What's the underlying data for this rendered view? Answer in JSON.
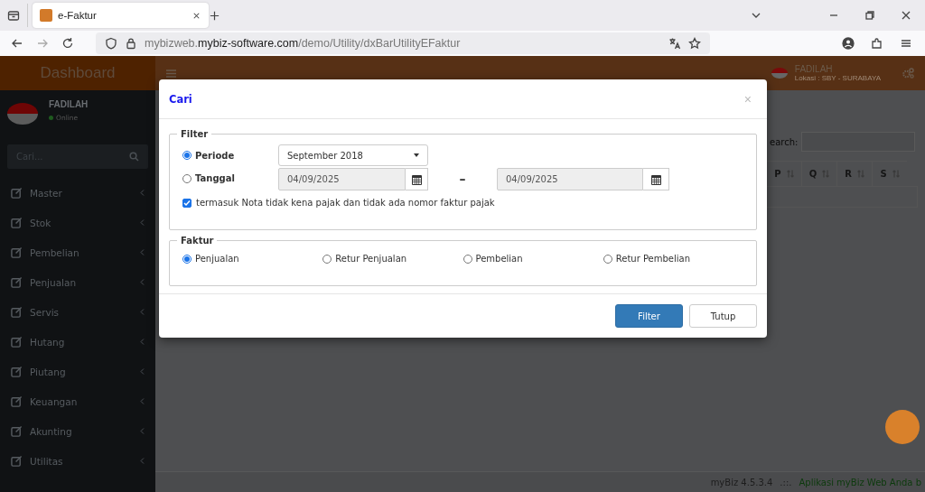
{
  "browser": {
    "tab_title": "e-Faktur",
    "url": {
      "subdomain": "mybizweb.",
      "domain": "mybiz-software.com",
      "path": "/demo/Utility/dxBarUtilityEFaktur"
    }
  },
  "header": {
    "brand": "Dashboard",
    "user_name": "FADILAH",
    "location": "Lokasi : SBY - SURABAYA"
  },
  "sidebar": {
    "user_name": "FADILAH",
    "status": "Online",
    "search": {
      "placeholder": "Cari..."
    },
    "items": [
      {
        "label": "Master"
      },
      {
        "label": "Stok"
      },
      {
        "label": "Pembelian"
      },
      {
        "label": "Penjualan"
      },
      {
        "label": "Servis"
      },
      {
        "label": "Hutang"
      },
      {
        "label": "Piutang"
      },
      {
        "label": "Keuangan"
      },
      {
        "label": "Akunting"
      },
      {
        "label": "Utilitas"
      }
    ]
  },
  "background_table": {
    "search_label": "earch:",
    "columns": [
      "P",
      "Q",
      "R",
      "S"
    ]
  },
  "modal": {
    "title": "Cari",
    "close": "×",
    "filter": {
      "legend": "Filter",
      "modes": [
        {
          "label": "Periode",
          "selected": true
        },
        {
          "label": "Tanggal",
          "selected": false
        }
      ],
      "period": {
        "value": "September 2018"
      },
      "date_from": {
        "value": "04/09/2025",
        "disabled": true
      },
      "range_separator": "–",
      "date_to": {
        "value": "04/09/2025",
        "disabled": true
      },
      "include_non_tax": {
        "label": "termasuk Nota tidak kena pajak dan tidak ada nomor faktur pajak",
        "checked": true
      }
    },
    "faktur": {
      "legend": "Faktur",
      "options": [
        {
          "label": "Penjualan",
          "selected": true
        },
        {
          "label": "Retur Penjualan",
          "selected": false
        },
        {
          "label": "Pembelian",
          "selected": false
        },
        {
          "label": "Retur Pembelian",
          "selected": false
        }
      ]
    },
    "buttons": [
      {
        "label": "Filter",
        "kind": "primary"
      },
      {
        "label": "Tutup",
        "kind": "default"
      }
    ]
  },
  "footer": {
    "version": "myBiz 4.5.3.4",
    "separator": ".::.",
    "tagline": "Aplikasi myBiz Web Anda b"
  }
}
